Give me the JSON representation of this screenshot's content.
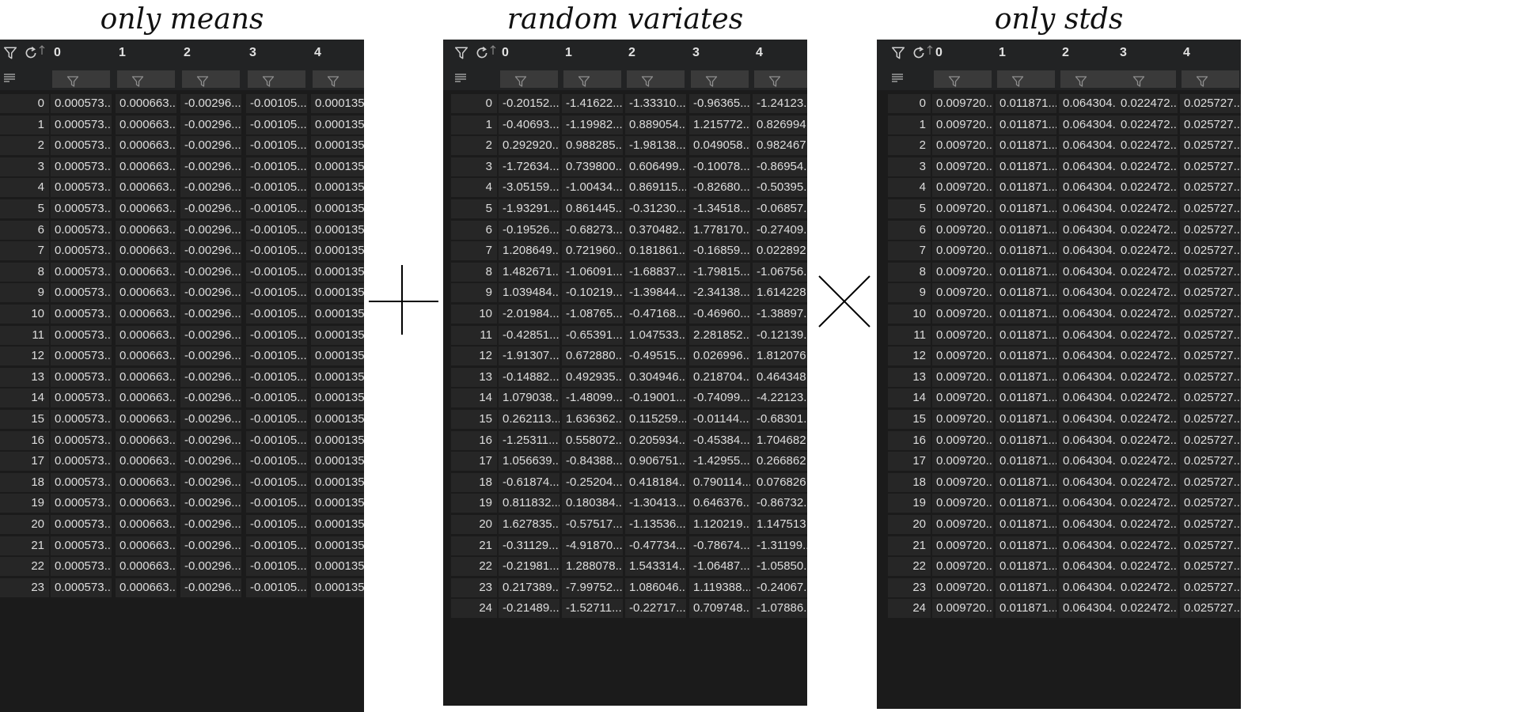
{
  "titles": {
    "means": "only means",
    "variates": "random variates",
    "stds": "only stds"
  },
  "columns": [
    "0",
    "1",
    "2",
    "3",
    "4"
  ],
  "icons": {
    "toolbar": [
      "filter-icon",
      "refresh-icon",
      "sort-up-icon",
      "list-filter-icon"
    ],
    "column_filter": "filter-icon",
    "plus": "plus-icon",
    "times": "times-icon"
  },
  "means": {
    "index": [
      "0",
      "1",
      "2",
      "3",
      "4",
      "5",
      "6",
      "7",
      "8",
      "9",
      "10",
      "11",
      "12",
      "13",
      "14",
      "15",
      "16",
      "17",
      "18",
      "19",
      "20",
      "21",
      "22",
      "23"
    ],
    "row_values": [
      "0.000573...",
      "0.000663...",
      "-0.00296...",
      "-0.00105...",
      "0.000135..."
    ]
  },
  "variates": {
    "index": [
      "0",
      "1",
      "2",
      "3",
      "4",
      "5",
      "6",
      "7",
      "8",
      "9",
      "10",
      "11",
      "12",
      "13",
      "14",
      "15",
      "16",
      "17",
      "18",
      "19",
      "20",
      "21",
      "22",
      "23",
      "24"
    ],
    "rows": [
      [
        "-0.20152...",
        "-1.41622...",
        "-1.33310...",
        "-0.96365...",
        "-1.24123..."
      ],
      [
        "-0.40693...",
        "-1.19982...",
        "0.889054...",
        "1.215772...",
        "0.826994..."
      ],
      [
        "0.292920...",
        "0.988285...",
        "-1.98138...",
        "0.049058...",
        "0.982467..."
      ],
      [
        "-1.72634...",
        "0.739800...",
        "0.606499...",
        "-0.10078...",
        "-0.86954..."
      ],
      [
        "-3.05159...",
        "-1.00434...",
        "0.869115...",
        "-0.82680...",
        "-0.50395..."
      ],
      [
        "-1.93291...",
        "0.861445...",
        "-0.31230...",
        "-1.34518...",
        "-0.06857..."
      ],
      [
        "-0.19526...",
        "-0.68273...",
        "0.370482...",
        "1.778170...",
        "-0.27409..."
      ],
      [
        "1.208649...",
        "0.721960...",
        "0.181861...",
        "-0.16859...",
        "0.022892..."
      ],
      [
        "1.482671...",
        "-1.06091...",
        "-1.68837...",
        "-1.79815...",
        "-1.06756..."
      ],
      [
        "1.039484...",
        "-0.10219...",
        "-1.39844...",
        "-2.34138...",
        "1.614228..."
      ],
      [
        "-2.01984...",
        "-1.08765...",
        "-0.47168...",
        "-0.46960...",
        "-1.38897..."
      ],
      [
        "-0.42851...",
        "-0.65391...",
        "1.047533...",
        "2.281852...",
        "-0.12139..."
      ],
      [
        "-1.91307...",
        "0.672880...",
        "-0.49515...",
        "0.026996...",
        "1.812076..."
      ],
      [
        "-0.14882...",
        "0.492935...",
        "0.304946...",
        "0.218704...",
        "0.464348..."
      ],
      [
        "1.079038...",
        "-1.48099...",
        "-0.19001...",
        "-0.74099...",
        "-4.22123..."
      ],
      [
        "0.262113...",
        "1.636362...",
        "0.115259...",
        "-0.01144...",
        "-0.68301..."
      ],
      [
        "-1.25311...",
        "0.558072...",
        "0.205934...",
        "-0.45384...",
        "1.704682..."
      ],
      [
        "1.056639...",
        "-0.84388...",
        "0.906751...",
        "-1.42955...",
        "0.266862..."
      ],
      [
        "-0.61874...",
        "-0.25204...",
        "0.418184...",
        "0.790114...",
        "0.076826..."
      ],
      [
        "0.811832...",
        "0.180384...",
        "-1.30413...",
        "0.646376...",
        "-0.86732..."
      ],
      [
        "1.627835...",
        "-0.57517...",
        "-1.13536...",
        "1.120219...",
        "1.147513..."
      ],
      [
        "-0.31129...",
        "-4.91870...",
        "-0.47734...",
        "-0.78674...",
        "-1.31199..."
      ],
      [
        "-0.21981...",
        "1.288078...",
        "1.543314...",
        "-1.06487...",
        "-1.05850..."
      ],
      [
        "0.217389...",
        "-7.99752...",
        "1.086046...",
        "1.119388...",
        "-0.24067..."
      ],
      [
        "-0.21489...",
        "-1.52711...",
        "-0.22717...",
        "0.709748...",
        "-1.07886..."
      ]
    ]
  },
  "stds": {
    "index": [
      "0",
      "1",
      "2",
      "3",
      "4",
      "5",
      "6",
      "7",
      "8",
      "9",
      "10",
      "11",
      "12",
      "13",
      "14",
      "15",
      "16",
      "17",
      "18",
      "19",
      "20",
      "21",
      "22",
      "23",
      "24"
    ],
    "row_values": [
      "0.009720...",
      "0.011871...",
      "0.064304...",
      "0.022472...",
      "0.025727..."
    ]
  }
}
